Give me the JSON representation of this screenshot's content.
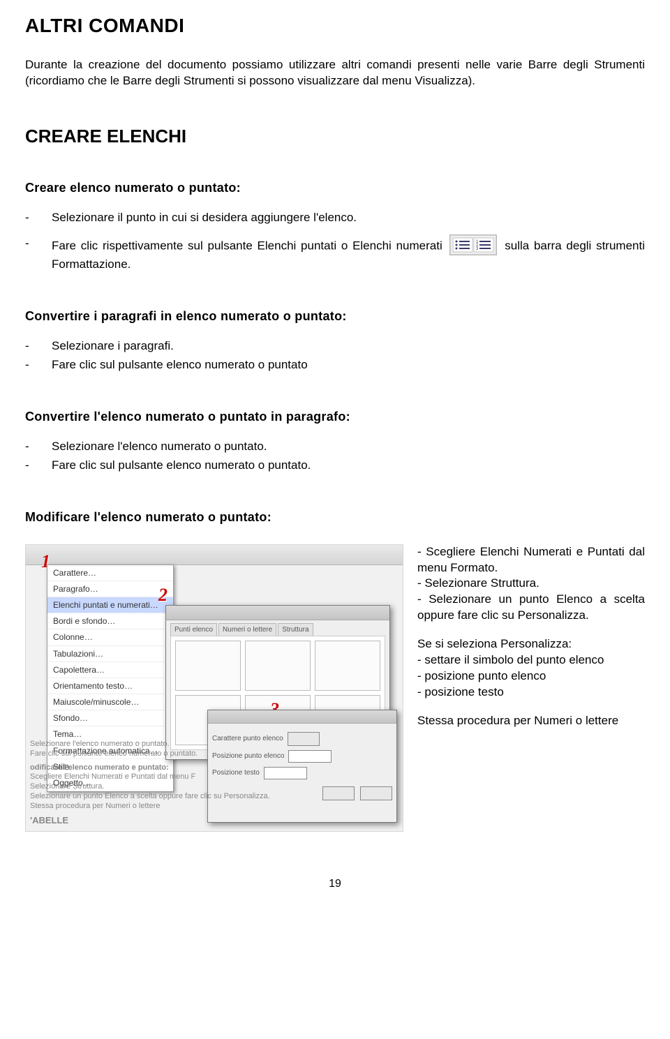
{
  "title": "ALTRI COMANDI",
  "intro": "Durante la creazione del documento possiamo utilizzare altri comandi presenti nelle varie Barre degli Strumenti (ricordiamo che le Barre degli Strumenti si possono visualizzare dal menu Visualizza).",
  "h2": "CREARE ELENCHI",
  "sec1": {
    "heading": "Creare elenco numerato o puntato:",
    "b1": "Selezionare il punto in cui si desidera aggiungere l'elenco.",
    "b2a": "Fare clic rispettivamente sul pulsante Elenchi puntati o Elenchi numerati",
    "b2b": "sulla barra degli strumenti Formattazione."
  },
  "sec2": {
    "heading": "Convertire i paragrafi in elenco numerato o puntato:",
    "b1": "Selezionare i paragrafi.",
    "b2": "Fare clic sul pulsante elenco numerato o puntato"
  },
  "sec3": {
    "heading": "Convertire l'elenco numerato o puntato in paragrafo:",
    "b1": "Selezionare l'elenco numerato o puntato.",
    "b2": "Fare clic sul pulsante elenco numerato o puntato."
  },
  "sec4": {
    "heading": "Modificare l'elenco numerato o puntato:",
    "r1": "- Scegliere Elenchi Numerati e Puntati dal menu Formato.",
    "r2": "- Selezionare Struttura.",
    "r3": "- Selezionare un punto Elenco a scelta oppure fare clic su Personalizza.",
    "r4": "Se si seleziona Personalizza:",
    "r5": "- settare il simbolo del punto elenco",
    "r6": "- posizione punto elenco",
    "r7": "- posizione testo",
    "r8": "Stessa procedura per Numeri o lettere"
  },
  "menuItems": [
    "Carattere…",
    "Paragrafo…",
    "Elenchi puntati e numerati…",
    "Bordi e sfondo…",
    "Colonne…",
    "Tabulazioni…",
    "Capolettera…",
    "Orientamento testo…",
    "Maiuscole/minuscole…",
    "Sfondo…",
    "Tema…",
    "Formattazione automatica…",
    "Stile…",
    "Oggetto…"
  ],
  "dialogTabs": [
    "Punti elenco",
    "Numeri o lettere",
    "Struttura"
  ],
  "blurLines": [
    "Selezionare l'elenco numerato o puntato.",
    "Fare clic sul pulsante elenco numerato o puntato.",
    "odificare l'elenco numerato e puntato:",
    "Scegliere Elenchi Numerati e Puntati dal menu F",
    "Selezionare Struttura.",
    "Selezionare un punto Elenco a scelta oppure fare clic su Personalizza.",
    "Stessa procedura per Numeri o lettere",
    "'ABELLE"
  ],
  "pageNumber": "19"
}
